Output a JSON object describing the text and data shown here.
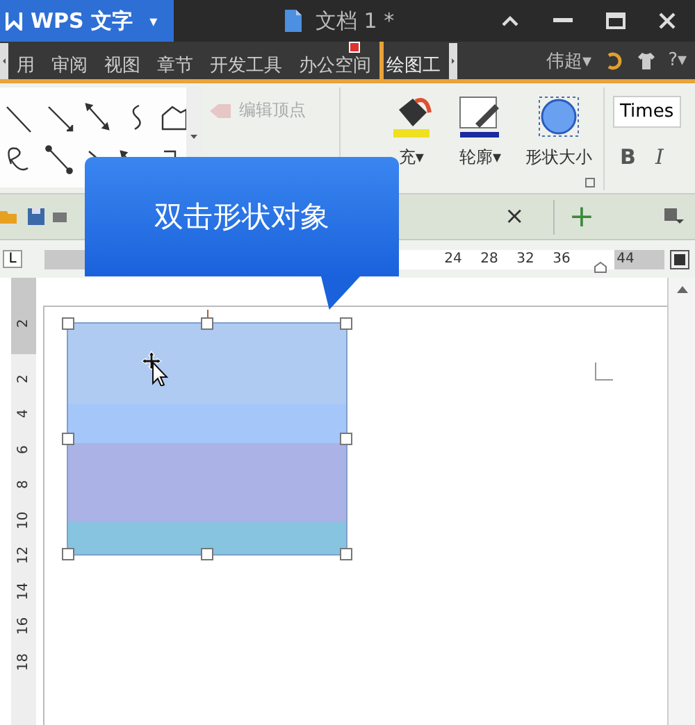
{
  "title_bar": {
    "app_name": "WPS 文字",
    "app_menu_caret": "▾",
    "document_title": "文档 1 *"
  },
  "menu_tabs": [
    {
      "label": "用",
      "selected": false,
      "badge": false
    },
    {
      "label": "审阅",
      "selected": false,
      "badge": false
    },
    {
      "label": "视图",
      "selected": false,
      "badge": false
    },
    {
      "label": "章节",
      "selected": false,
      "badge": false
    },
    {
      "label": "开发工具",
      "selected": false,
      "badge": false
    },
    {
      "label": "办公空间",
      "selected": false,
      "badge": true
    },
    {
      "label": "绘图工",
      "selected": true,
      "badge": false
    }
  ],
  "user": {
    "name": "伟超▾"
  },
  "help": "?▾",
  "ribbon": {
    "edit_points": {
      "label": "编辑顶点",
      "disabled": true
    },
    "fill": {
      "label": "充▾"
    },
    "outline": {
      "label": "轮廓▾"
    },
    "shape_size": {
      "label": "形状大小"
    },
    "font_name": "Times",
    "bold": "B",
    "italic": "I"
  },
  "doc_tabs": {
    "close": "×",
    "new": "+"
  },
  "ruler": {
    "corner": "L",
    "ticks": [
      "24",
      "28",
      "32",
      "36",
      "44"
    ]
  },
  "vertical_ruler": [
    "2",
    "2",
    "4",
    "6",
    "8",
    "10",
    "12",
    "14",
    "16",
    "18"
  ],
  "callout": {
    "text": "双击形状对象"
  },
  "shape": {
    "selected": true
  }
}
